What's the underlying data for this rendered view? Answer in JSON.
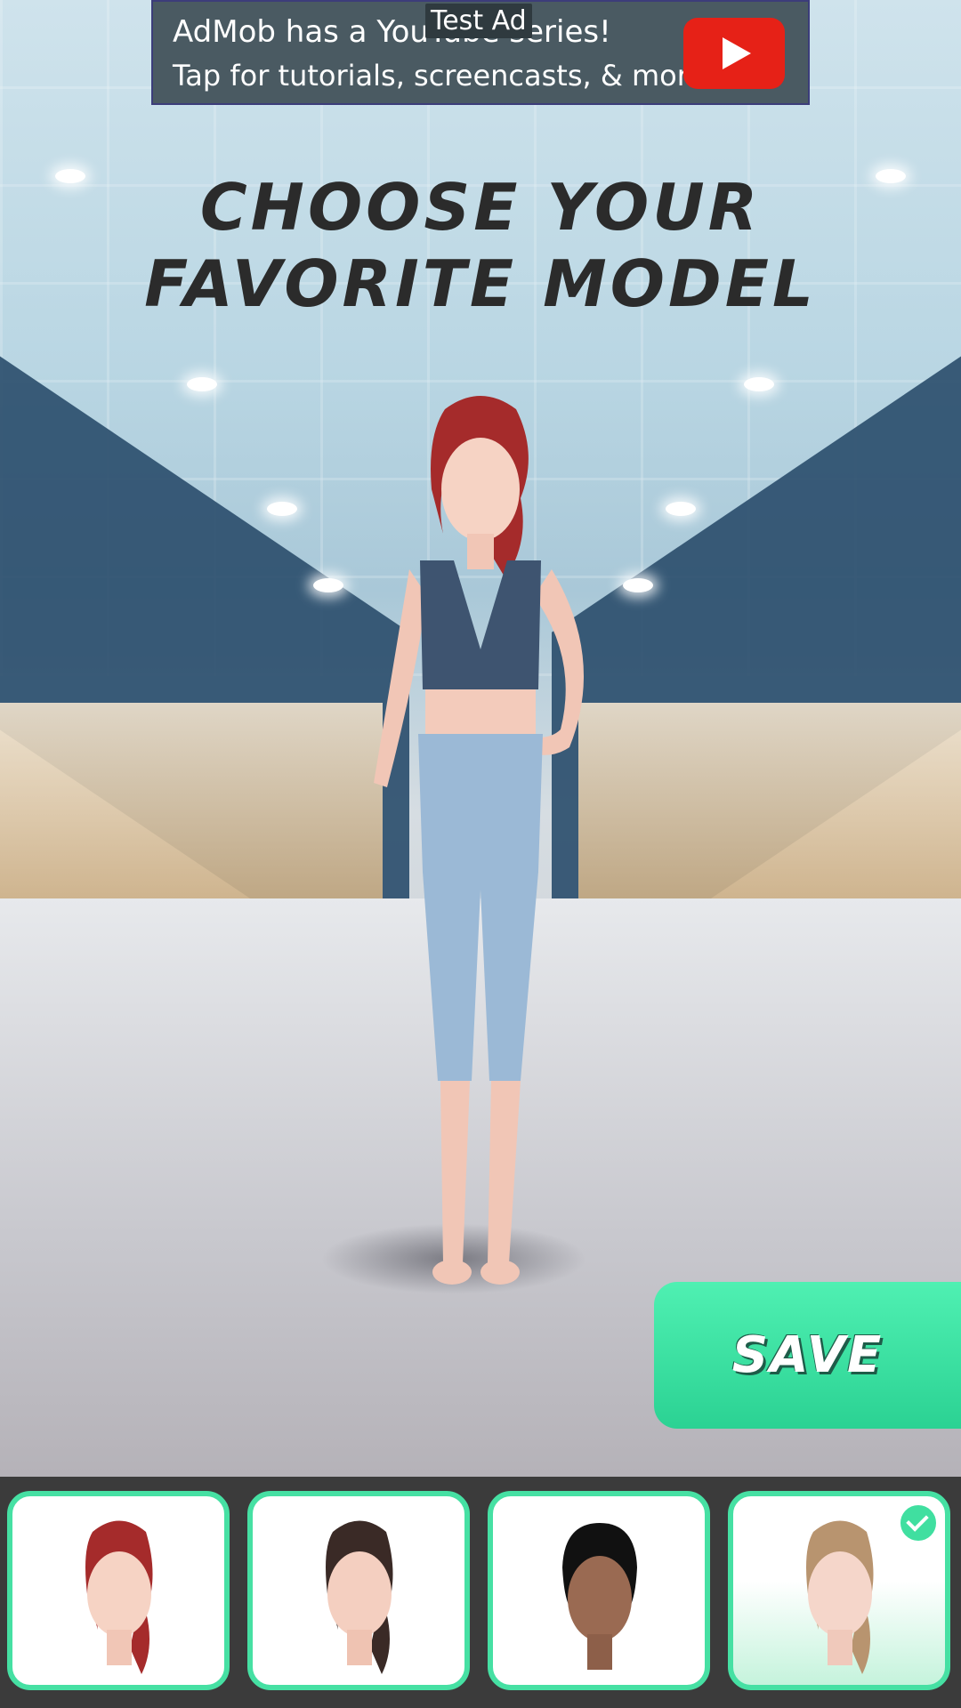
{
  "ad": {
    "tag": "Test Ad",
    "line1": "AdMob has a YouTube series!",
    "line2": "Tap for tutorials, screencasts, & more.",
    "icon": "youtube-play-icon"
  },
  "title": "CHOOSE YOUR FAVORITE MODEL",
  "save_button": {
    "label": "SAVE"
  },
  "models": [
    {
      "name": "model-red-ponytail",
      "selected": false
    },
    {
      "name": "model-brunette-ponytail",
      "selected": false
    },
    {
      "name": "model-black-bun",
      "selected": false
    },
    {
      "name": "model-blonde-ponytail",
      "selected": true
    }
  ],
  "colors": {
    "accent": "#46e0a3",
    "bar": "#3b3b3b",
    "title": "#2b2b2b"
  }
}
